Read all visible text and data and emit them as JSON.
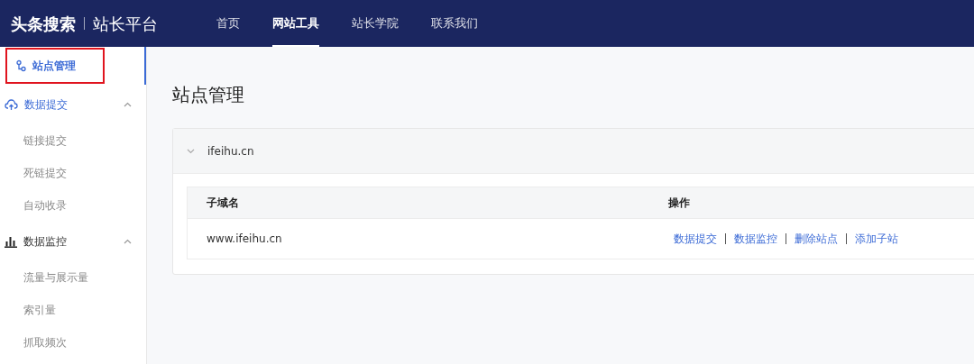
{
  "header": {
    "brand": "头条搜索",
    "platform": "站长平台",
    "nav": [
      {
        "label": "首页",
        "selected": false
      },
      {
        "label": "网站工具",
        "selected": true
      },
      {
        "label": "站长学院",
        "selected": false
      },
      {
        "label": "联系我们",
        "selected": false
      }
    ]
  },
  "sidebar": {
    "items": [
      {
        "kind": "link",
        "label": "站点管理",
        "selected": true,
        "highlighted": true
      },
      {
        "kind": "group",
        "label": "数据提交",
        "expanded": true,
        "children": [
          {
            "label": "链接提交",
            "selected": false
          },
          {
            "label": "死链提交",
            "selected": false
          },
          {
            "label": "自动收录",
            "selected": false
          }
        ]
      },
      {
        "kind": "group",
        "label": "数据监控",
        "expanded": true,
        "children": [
          {
            "label": "流量与展示量",
            "selected": false
          },
          {
            "label": "索引量",
            "selected": false
          },
          {
            "label": "抓取频次",
            "selected": false
          }
        ]
      }
    ]
  },
  "page": {
    "title": "站点管理",
    "site": {
      "domain": "ifeihu.cn",
      "expanded": true,
      "table": {
        "columns": [
          "子域名",
          "操作"
        ],
        "rows": [
          {
            "subdomain": "www.ifeihu.cn",
            "actions": [
              "数据提交",
              "数据监控",
              "删除站点",
              "添加子站"
            ]
          }
        ]
      }
    }
  }
}
